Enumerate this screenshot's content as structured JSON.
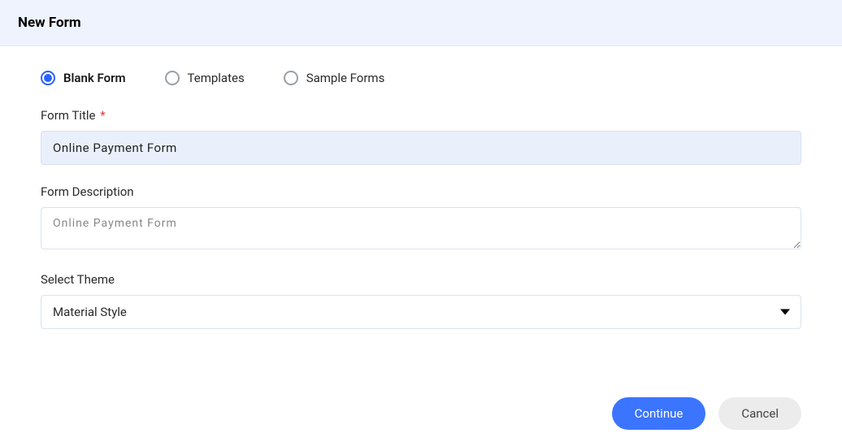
{
  "header": {
    "title": "New Form"
  },
  "radios": {
    "blank": "Blank Form",
    "templates": "Templates",
    "sample": "Sample Forms",
    "selected": "blank"
  },
  "fields": {
    "title": {
      "label": "Form Title",
      "value": "Online Payment Form",
      "required": "*"
    },
    "description": {
      "label": "Form Description",
      "value": "Online Payment Form"
    },
    "theme": {
      "label": "Select Theme",
      "value": "Material Style"
    }
  },
  "buttons": {
    "continue": "Continue",
    "cancel": "Cancel"
  }
}
